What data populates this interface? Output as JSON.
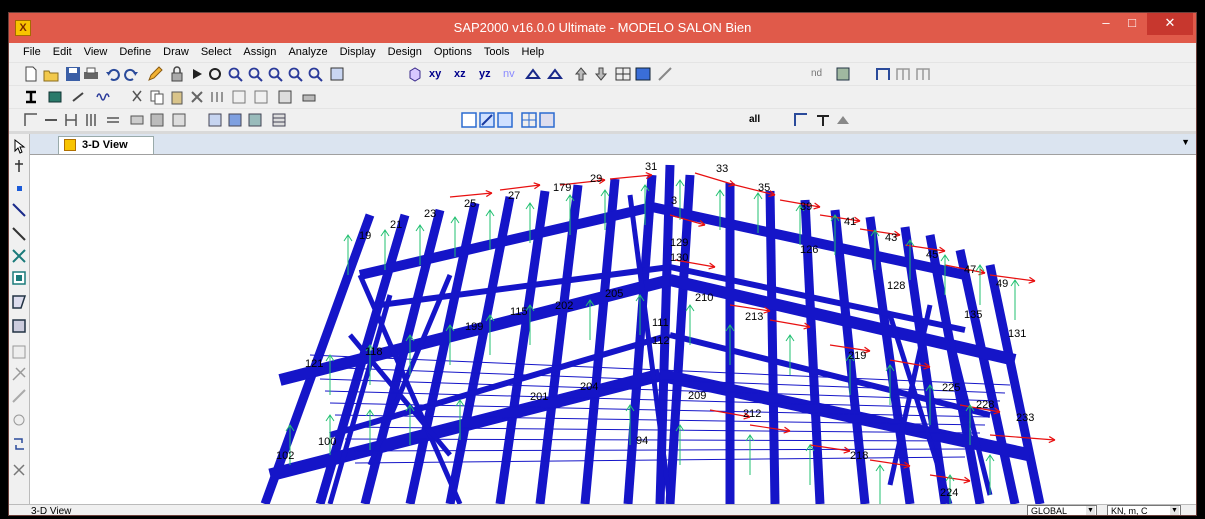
{
  "window": {
    "title": "SAP2000 v16.0.0 Ultimate  - MODELO SALON  Bien",
    "minimize_glyph": "‒",
    "maximize_glyph": "□",
    "close_glyph": "✕"
  },
  "menu": [
    "File",
    "Edit",
    "View",
    "Define",
    "Draw",
    "Select",
    "Assign",
    "Analyze",
    "Display",
    "Design",
    "Options",
    "Tools",
    "Help"
  ],
  "toolbar": {
    "view_xy": "xy",
    "view_xz": "xz",
    "view_yz": "yz",
    "view_nv": "nv",
    "nd_label": "nd",
    "all_label": "all"
  },
  "tab": {
    "label": "3-D View",
    "dropdown_glyph": "▼"
  },
  "status": {
    "text": "3-D View",
    "coord_system": "GLOBAL",
    "units": "KN, m, C"
  },
  "model": {
    "joint_labels": [
      "31",
      "29",
      "179",
      "27",
      "25",
      "23",
      "21",
      "19",
      "33",
      "35",
      "39",
      "41",
      "43",
      "45",
      "47",
      "49",
      "3",
      "129",
      "130",
      "126",
      "128",
      "210",
      "213",
      "135",
      "131",
      "111",
      "112",
      "209",
      "212",
      "219",
      "225",
      "228",
      "233",
      "201",
      "204",
      "218",
      "224",
      "94",
      "102",
      "199",
      "202",
      "205",
      "115",
      "118",
      "121",
      "100"
    ],
    "colors": {
      "frame": "#1515c8",
      "load_arrow": "#e81010",
      "support_arrow": "#20c070",
      "label": "#000000"
    }
  }
}
